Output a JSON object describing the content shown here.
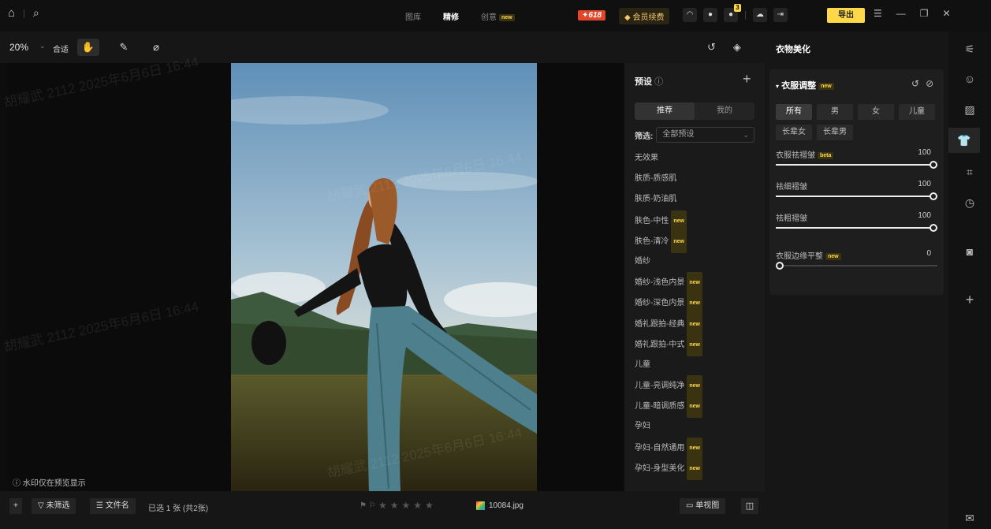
{
  "topbar": {
    "tabs": [
      "图库",
      "精修",
      "创意"
    ],
    "active_tab": "精修",
    "new_badge": "new",
    "promo": "✦618",
    "vip_label": "会员续费",
    "notification_count": "3",
    "export_label": "导出"
  },
  "toolbar": {
    "zoom": "20%",
    "fit_label": "合适"
  },
  "canvas": {
    "watermark_note": "水印仅在预览显示",
    "watermark_text": "胡耀武 2112 2025年6月6日 16:44"
  },
  "presets": {
    "title": "预设",
    "tabs": [
      "推荐",
      "我的"
    ],
    "filter_label": "筛选:",
    "filter_value": "全部预设",
    "items": [
      {
        "label": "无效果",
        "new": false
      },
      {
        "label": "肤质-质感肌",
        "new": false
      },
      {
        "label": "肤质-奶油肌",
        "new": false
      },
      {
        "label": "肤色-中性",
        "new": true
      },
      {
        "label": "肤色-清冷",
        "new": true
      },
      {
        "label": "婚纱",
        "new": false
      },
      {
        "label": "婚纱-浅色内景",
        "new": true
      },
      {
        "label": "婚纱-深色内景",
        "new": true
      },
      {
        "label": "婚礼跟拍-经典",
        "new": true
      },
      {
        "label": "婚礼跟拍-中式",
        "new": true
      },
      {
        "label": "儿童",
        "new": false
      },
      {
        "label": "儿童-亮调纯净",
        "new": true
      },
      {
        "label": "儿童-暗调质感",
        "new": true
      },
      {
        "label": "孕妇",
        "new": false
      },
      {
        "label": "孕妇-自然通用",
        "new": true
      },
      {
        "label": "孕妇-身型美化",
        "new": true
      }
    ]
  },
  "panel": {
    "title": "衣物美化",
    "section_title": "衣服调整",
    "chips": [
      "所有",
      "男",
      "女",
      "儿童",
      "长辈女",
      "长辈男"
    ],
    "sliders": [
      {
        "label": "衣服祛褶皱",
        "badge": "beta",
        "value": "100",
        "level": 1.0
      },
      {
        "label": "祛细褶皱",
        "badge": "",
        "value": "100",
        "level": 1.0
      },
      {
        "label": "祛粗褶皱",
        "badge": "",
        "value": "100",
        "level": 1.0
      },
      {
        "label": "衣服边缘平整",
        "badge": "new",
        "value": "0",
        "level": 0.0
      }
    ]
  },
  "bottombar": {
    "filter_btn": "未筛选",
    "filename_btn": "文件名",
    "selection_text": "已选 1 张 (共2张)",
    "file_name": "10084.jpg",
    "single_view": "单视图"
  }
}
